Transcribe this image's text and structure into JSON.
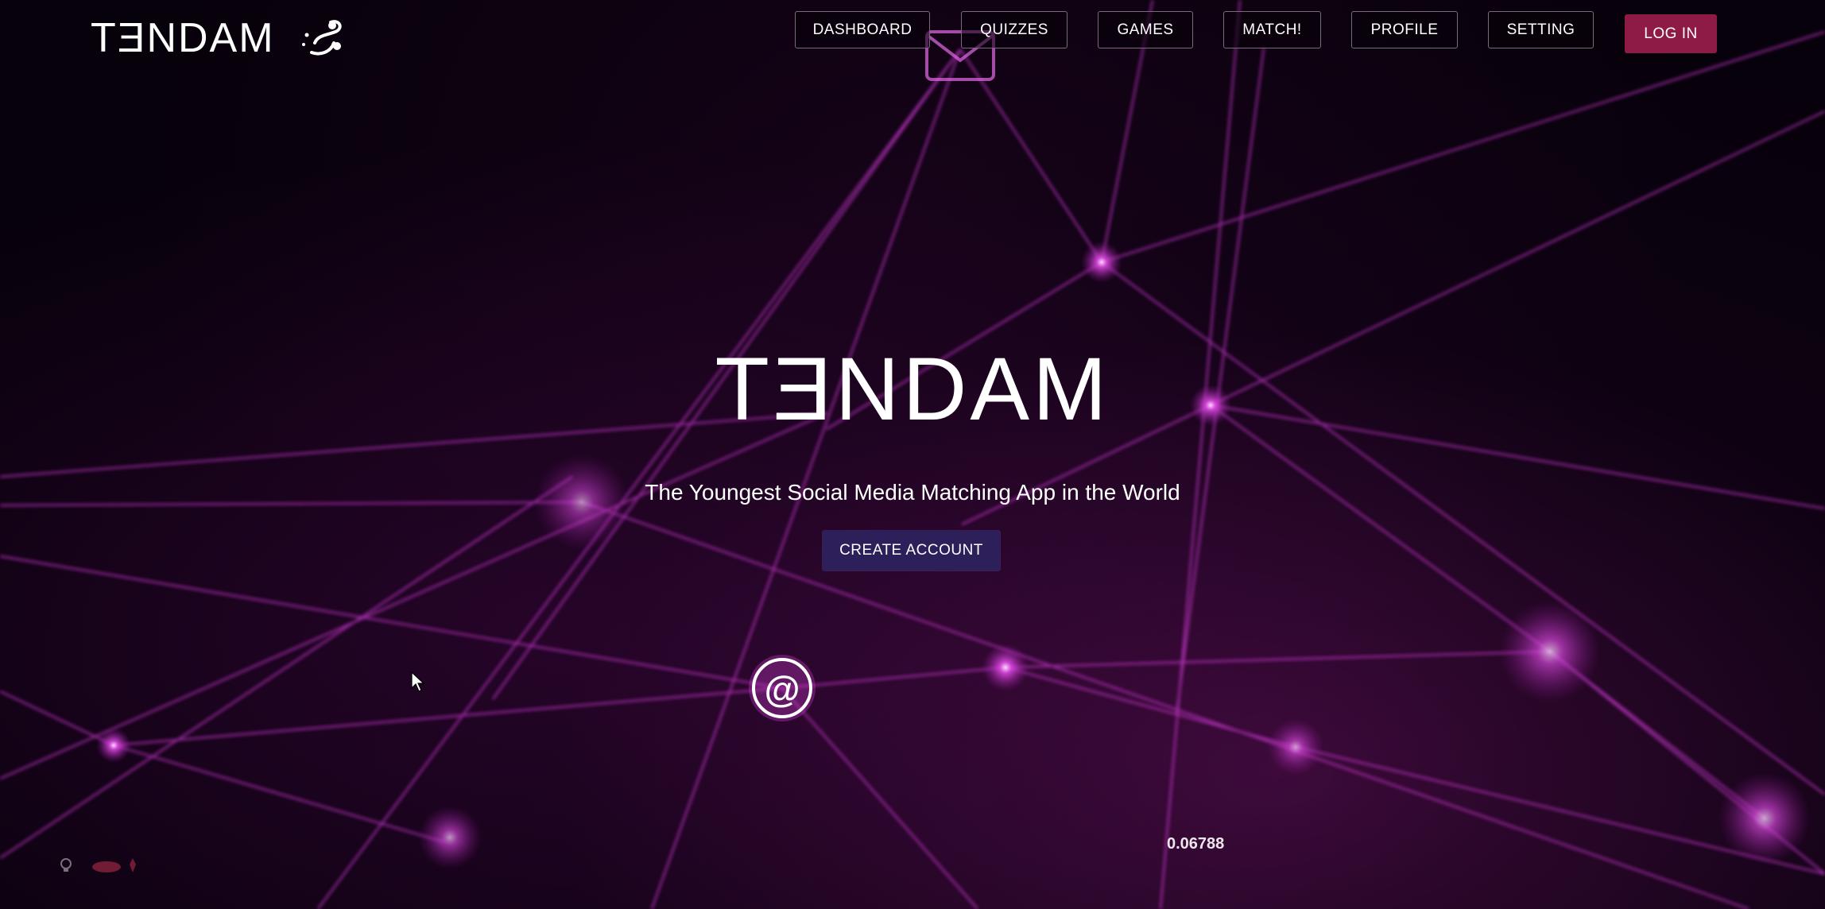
{
  "header": {
    "brand_text": "TƎNDAM",
    "brand_icon": "tandem-swirl-icon"
  },
  "nav": {
    "items": [
      {
        "label": "DASHBOARD"
      },
      {
        "label": "QUIZZES"
      },
      {
        "label": "GAMES"
      },
      {
        "label": "MATCH!"
      },
      {
        "label": "PROFILE"
      },
      {
        "label": "SETTING"
      }
    ],
    "login_label": "LOG IN"
  },
  "hero": {
    "title": "TƎNDAM",
    "subtitle": "The Youngest Social Media Matching App in the World",
    "cta_label": "CREATE ACCOUNT"
  },
  "background": {
    "floating_number": "0.06788",
    "icons": [
      "envelope-icon",
      "at-sign-icon"
    ]
  },
  "colors": {
    "background": "#07010b",
    "network_line": "#d23bd8",
    "login_button": "#8e1b46",
    "cta_button": "#2c1f5a",
    "nav_border": "#7b6b7a"
  }
}
